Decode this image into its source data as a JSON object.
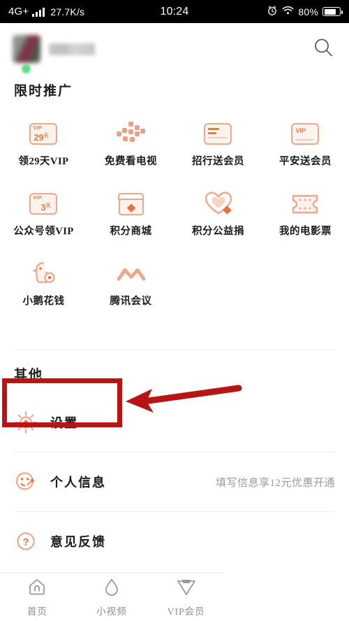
{
  "status_bar": {
    "network": "4G+",
    "speed": "27.7K/s",
    "time": "10:24",
    "battery_percent": "80%",
    "icons": [
      "signal-bars-icon",
      "alarm-clock-icon",
      "wifi-icon",
      "battery-icon"
    ]
  },
  "header": {
    "avatar": "user-avatar-blurred",
    "username": "",
    "search_icon": "search-icon"
  },
  "promo_section": {
    "title": "限时推广",
    "items": [
      {
        "label": "领29天VIP",
        "icon": "vip-card-29-days-icon",
        "vip_tag": "VIP",
        "days": "29",
        "days_unit": "天"
      },
      {
        "label": "免费看电视",
        "icon": "tv-dots-icon"
      },
      {
        "label": "招行送会员",
        "icon": "bank-card-cmb-icon"
      },
      {
        "label": "平安送会员",
        "icon": "vip-card-pingan-icon",
        "vip_tag": "VIP"
      },
      {
        "label": "公众号领VIP",
        "icon": "vip-card-3-days-icon",
        "vip_tag": "VIP",
        "days": "3",
        "days_unit": "天"
      },
      {
        "label": "积分商城",
        "icon": "points-store-icon"
      },
      {
        "label": "积分公益捐",
        "icon": "charity-heart-icon"
      },
      {
        "label": "我的电影票",
        "icon": "movie-ticket-icon"
      },
      {
        "label": "小鹅花钱",
        "icon": "goose-wallet-icon"
      },
      {
        "label": "腾讯会议",
        "icon": "tencent-meeting-icon"
      }
    ]
  },
  "other_section": {
    "title": "其他",
    "rows": [
      {
        "label": "设置",
        "icon": "settings-gear-icon",
        "hint": ""
      },
      {
        "label": "个人信息",
        "icon": "profile-wrench-icon",
        "hint": "填写信息享12元优惠开通"
      },
      {
        "label": "意见反馈",
        "icon": "question-mark-icon",
        "hint": ""
      }
    ]
  },
  "bottom_nav": {
    "items": [
      {
        "label": "首页",
        "icon": "home-icon"
      },
      {
        "label": "小视频",
        "icon": "droplet-icon"
      },
      {
        "label": "VIP会员",
        "icon": "bowtie-vip-icon"
      }
    ]
  },
  "annotations": {
    "highlight_box": "red-rectangle-around-settings",
    "arrow": "red-arrow-pointing-to-settings",
    "color": "#b81414"
  },
  "colors": {
    "accent": "#e8733c",
    "icon_outline": "#eaa98e",
    "text_primary": "#1b1b1b",
    "text_muted": "#9a9a9a",
    "nav_text": "#8d8d8d"
  }
}
